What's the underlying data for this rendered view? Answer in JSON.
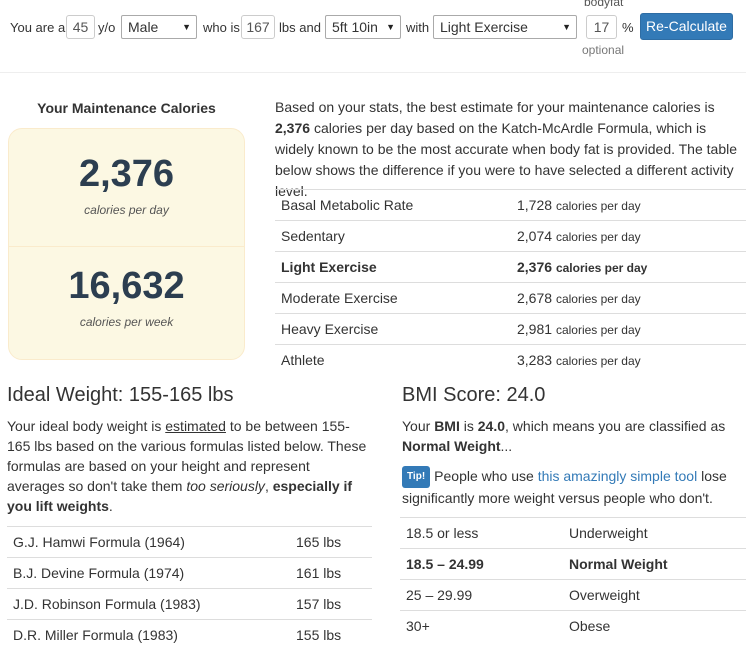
{
  "form": {
    "you_are_a": "You are a",
    "age_value": "45",
    "yo": "y/o",
    "gender_value": "Male",
    "who_is": "who is",
    "weight_value": "167",
    "lbs_and": "lbs and",
    "height_value": "5ft 10in",
    "with": "with",
    "activity_value": "Light Exercise",
    "bodyfat_label": "bodyfat",
    "bodyfat_value": "17",
    "percent": "%",
    "optional": "optional",
    "recalc_label": "Re-Calculate"
  },
  "maintenance": {
    "title": "Your Maintenance Calories",
    "per_day_value": "2,376",
    "per_day_label": "calories per day",
    "per_week_value": "16,632",
    "per_week_label": "calories per week"
  },
  "intro": {
    "text1": "Based on your stats, the best estimate for your maintenance calories is",
    "bold_value": "2,376",
    "text2": "calories per day based on the Katch-McArdle Formula, which is widely known to be the most accurate when body fat is provided. The table below shows the difference if you were to have selected a different activity level."
  },
  "activity_table": [
    {
      "label": "Basal Metabolic Rate",
      "value": "1,728",
      "unit": "calories per day",
      "bold": false
    },
    {
      "label": "Sedentary",
      "value": "2,074",
      "unit": "calories per day",
      "bold": false
    },
    {
      "label": "Light Exercise",
      "value": "2,376",
      "unit": "calories per day",
      "bold": true
    },
    {
      "label": "Moderate Exercise",
      "value": "2,678",
      "unit": "calories per day",
      "bold": false
    },
    {
      "label": "Heavy Exercise",
      "value": "2,981",
      "unit": "calories per day",
      "bold": false
    },
    {
      "label": "Athlete",
      "value": "3,283",
      "unit": "calories per day",
      "bold": false
    }
  ],
  "ideal": {
    "heading": "Ideal Weight: 155-165 lbs",
    "p1": "Your ideal body weight is",
    "p_link": "estimated",
    "p2": "to be between 155-165 lbs based on the various formulas listed below. These formulas are based on your height and represent averages so don't take them",
    "p_italic": "too seriously",
    "p3": ",",
    "p_bold": "especially if you lift weights",
    "p4": ".",
    "rows": [
      {
        "formula": "G.J. Hamwi Formula (1964)",
        "value": "165 lbs"
      },
      {
        "formula": "B.J. Devine Formula (1974)",
        "value": "161 lbs"
      },
      {
        "formula": "J.D. Robinson Formula (1983)",
        "value": "157 lbs"
      },
      {
        "formula": "D.R. Miller Formula (1983)",
        "value": "155 lbs"
      }
    ]
  },
  "bmi": {
    "heading": "BMI Score: 24.0",
    "p1": "Your",
    "p_bmi": "BMI",
    "p2": "is",
    "p_value": "24.0",
    "p3": ", which means you are classified as",
    "p_class": "Normal Weight",
    "p4": "...",
    "tip_badge": "Tip!",
    "tip1": "People who use",
    "tip_link": "this amazingly simple tool",
    "tip2": "lose significantly more weight versus people who don't.",
    "rows": [
      {
        "range": "18.5 or less",
        "category": "Underweight",
        "bold": false
      },
      {
        "range": "18.5 – 24.99",
        "category": "Normal Weight",
        "bold": true
      },
      {
        "range": "25 – 29.99",
        "category": "Overweight",
        "bold": false
      },
      {
        "range": "30+",
        "category": "Obese",
        "bold": false
      }
    ]
  },
  "colors": {
    "accent": "#337ab7",
    "card_bg": "#fcf8e3",
    "card_border": "#faebcc",
    "number_color": "#2c3e50"
  }
}
